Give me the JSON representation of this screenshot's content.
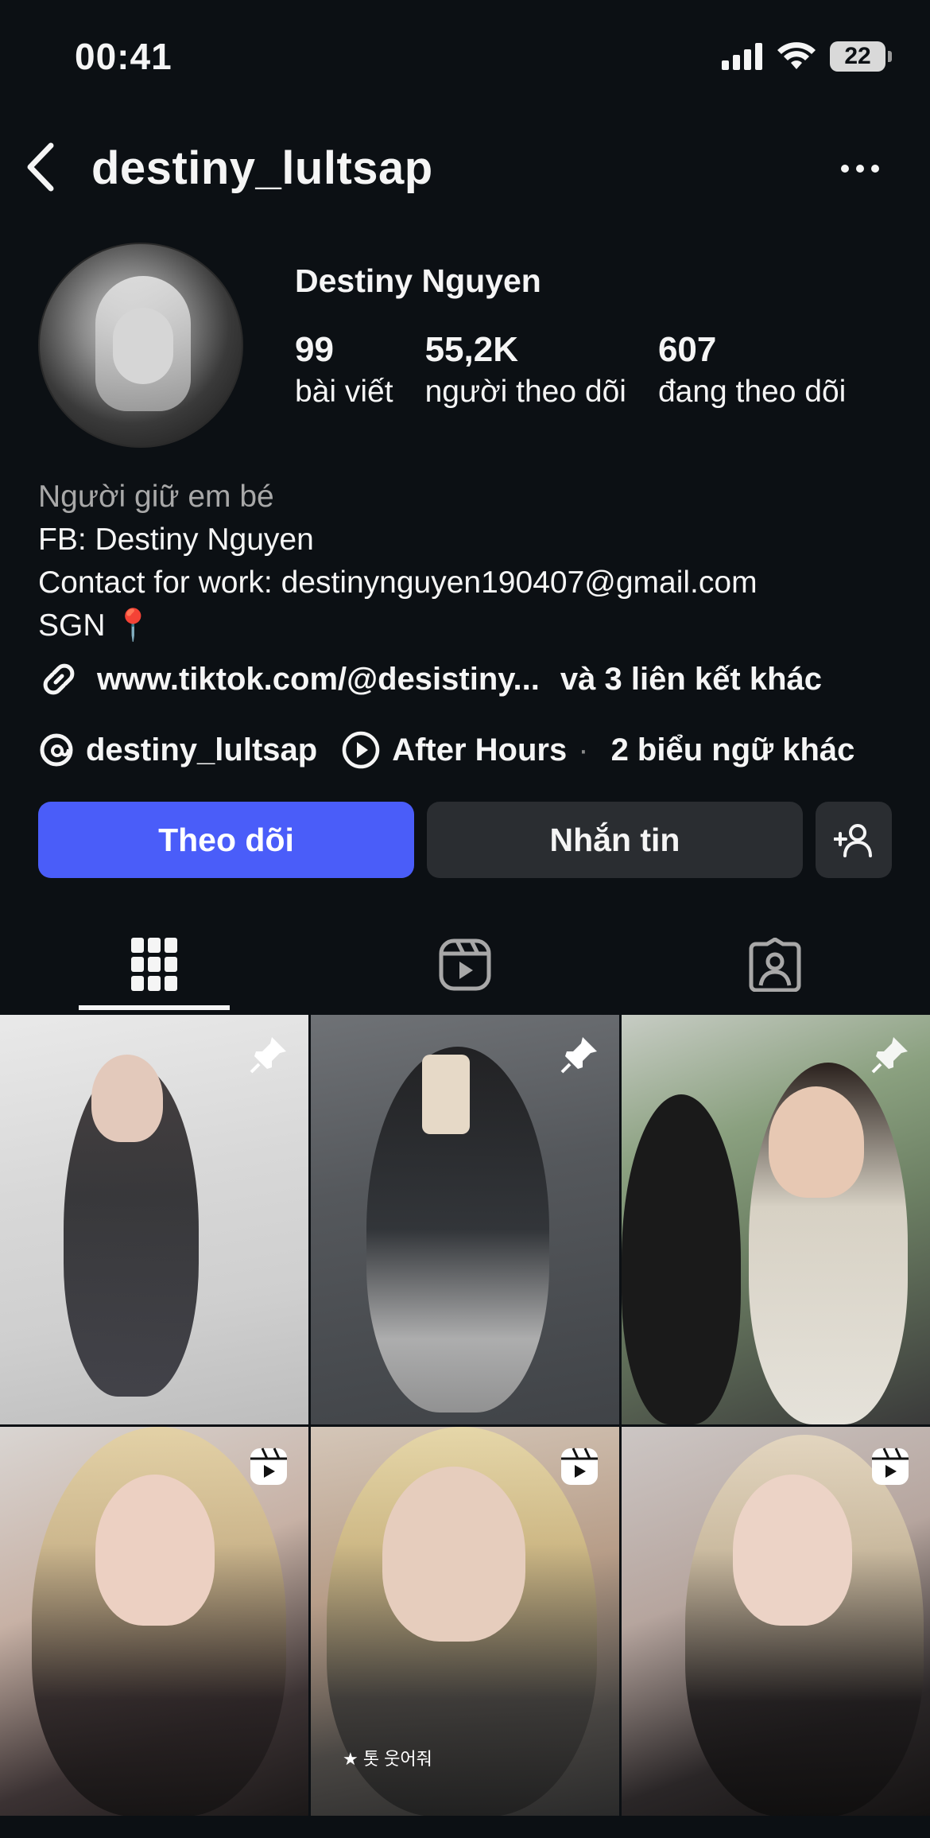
{
  "status_bar": {
    "time": "00:41",
    "battery": "22"
  },
  "nav": {
    "username": "destiny_lultsap"
  },
  "profile": {
    "display_name": "Destiny Nguyen",
    "stats": [
      {
        "value": "99",
        "label": "bài viết"
      },
      {
        "value": "55,2K",
        "label": "người theo dõi"
      },
      {
        "value": "607",
        "label": "đang theo dõi"
      }
    ],
    "bio": {
      "category": "Người giữ em bé",
      "line1": "FB: Destiny Nguyen",
      "line2": "Contact for work: destinynguyen190407@gmail.com",
      "line3": "SGN 📍"
    },
    "link": {
      "url": "www.tiktok.com/@desistiny...",
      "more": "và 3 liên kết khác"
    },
    "banners": {
      "threads": "destiny_lultsap",
      "music": "After Hours",
      "separator": "·",
      "more": "2 biểu ngữ khác"
    }
  },
  "actions": {
    "follow": "Theo dõi",
    "message": "Nhắn tin"
  },
  "tiles": [
    {
      "badge": "pin-icon"
    },
    {
      "badge": "pin-icon"
    },
    {
      "badge": "pin-icon"
    },
    {
      "badge": "reel-icon"
    },
    {
      "badge": "reel-icon",
      "caption": "★ 톳 웃어줘"
    },
    {
      "badge": "reel-icon"
    }
  ]
}
